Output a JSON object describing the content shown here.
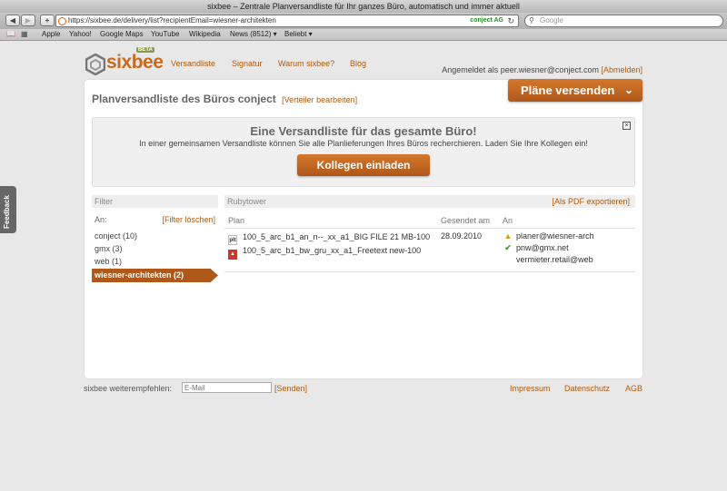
{
  "window": {
    "title": "sixbee – Zentrale Planversandliste für Ihr ganzes Büro, automatisch und immer aktuell"
  },
  "browser": {
    "url": "https://sixbee.de/delivery/list?recipientEmail=wiesner-architekten",
    "site_label": "conject AG",
    "search_placeholder": "Google",
    "bookmarks": [
      "Apple",
      "Yahoo!",
      "Google Maps",
      "YouTube",
      "Wikipedia",
      "News (8512) ▾",
      "Beliebt ▾"
    ]
  },
  "feedback_label": "Feedback",
  "brand": {
    "name": "sixbee",
    "badge": "BETA"
  },
  "nav": [
    "Versandliste",
    "Signatur",
    "Warum sixbee?",
    "Blog"
  ],
  "login": {
    "text": "Angemeldet als peer.wiesner@conject.com",
    "logout": "[Abmelden]"
  },
  "page": {
    "title": "Planversandliste des Büros conject",
    "edit_link": "[Verteiler bearbeiten]",
    "send_button": "Pläne versenden"
  },
  "promo": {
    "heading": "Eine Versandliste für das gesamte Büro!",
    "text": "In einer gemeinsamen Versandliste können Sie alle Planlieferungen Ihres Büros recherchieren. Laden Sie Ihre Kollegen ein!",
    "button": "Kollegen einladen"
  },
  "filter": {
    "header": "Filter",
    "an_label": "An:",
    "clear_link": "[Filter löschen]",
    "items": [
      "conject (10)",
      "gmx (3)",
      "web (1)"
    ],
    "active": "wiesner-architekten (2)"
  },
  "content": {
    "project": "Rubytower",
    "export_link": "[Als PDF exportieren]",
    "columns": {
      "plan": "Plan",
      "sent": "Gesendet am",
      "to": "An"
    },
    "plans": [
      {
        "icon": "plt",
        "name": "100_5_arc_b1_an_n--_xx_a1_BIG FILE 21 MB-100"
      },
      {
        "icon": "pdf",
        "name": "100_5_arc_b1_bw_gru_xx_a1_Freetext new-100"
      }
    ],
    "date": "28.09.2010",
    "recipients": [
      {
        "status": "warning",
        "email": "planer@wiesner-arch"
      },
      {
        "status": "ok",
        "email": "pnw@gmx.net"
      },
      {
        "status": "none",
        "email": "vermieter.retail@web"
      }
    ]
  },
  "footer": {
    "recommend_label": "sixbee weiterempfehlen:",
    "email_placeholder": "E-Mail",
    "send_link": "[Senden]",
    "links": [
      "Impressum",
      "Datenschutz",
      "AGB"
    ]
  },
  "colors": {
    "brand_orange": "#b0571a",
    "link_orange": "#b05a10",
    "background": "#e8e8e8"
  }
}
